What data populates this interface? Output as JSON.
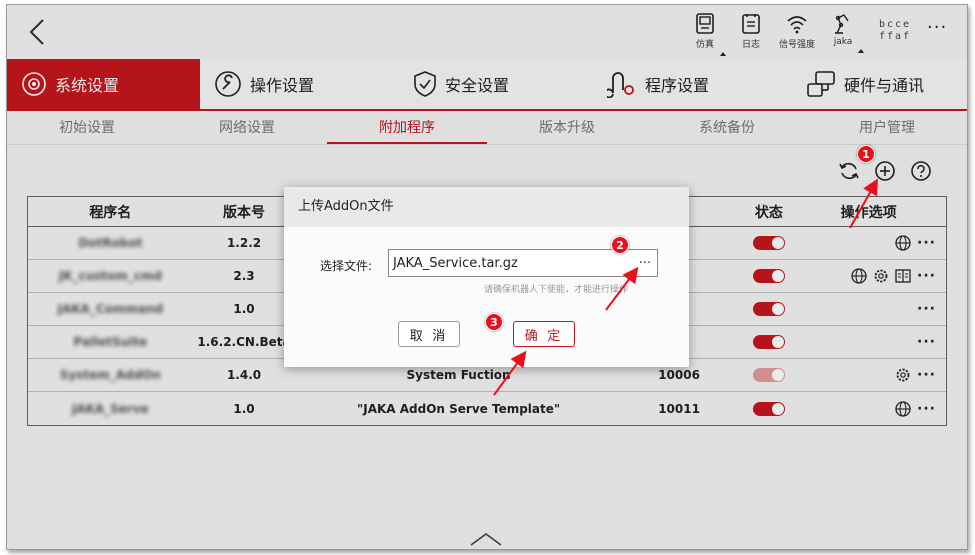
{
  "topbar": {
    "items": [
      {
        "label": "仿真",
        "icon": "simulation-icon"
      },
      {
        "label": "日志",
        "icon": "log-icon"
      },
      {
        "label": "信号强度",
        "icon": "wifi-icon"
      },
      {
        "label": "jaka",
        "icon": "robot-arm-icon"
      }
    ],
    "user_code_line1": "bcce",
    "user_code_line2": "ffaf",
    "more": "···"
  },
  "main_tabs": [
    {
      "label": "系统设置",
      "icon": "gear-cycle-icon",
      "active": true
    },
    {
      "label": "操作设置",
      "icon": "wrench-icon",
      "active": false
    },
    {
      "label": "安全设置",
      "icon": "shield-icon",
      "active": false
    },
    {
      "label": "程序设置",
      "icon": "program-icon",
      "active": false
    },
    {
      "label": "硬件与通讯",
      "icon": "hardware-icon",
      "active": false
    }
  ],
  "sub_tabs": [
    {
      "label": "初始设置",
      "active": false
    },
    {
      "label": "网络设置",
      "active": false
    },
    {
      "label": "附加程序",
      "active": true
    },
    {
      "label": "版本升级",
      "active": false
    },
    {
      "label": "系统备份",
      "active": false
    },
    {
      "label": "用户管理",
      "active": false
    }
  ],
  "table": {
    "headers": {
      "name": "程序名",
      "version": "版本号",
      "description": "",
      "id": "",
      "state": "状态",
      "ops": "操作选项"
    },
    "rows": [
      {
        "name": "DotRobot",
        "version": "1.2.2",
        "description": "",
        "id": "",
        "enabled": true,
        "ops": [
          "globe-icon"
        ]
      },
      {
        "name": "JK_custom_cmd",
        "version": "2.3",
        "description": "",
        "id": "",
        "enabled": true,
        "ops": [
          "globe-icon",
          "gear-icon",
          "book-icon"
        ]
      },
      {
        "name": "JAKA_Command",
        "version": "1.0",
        "description": "",
        "id": "",
        "enabled": true,
        "ops": []
      },
      {
        "name": "PalletSuite",
        "version": "1.6.2.CN.Beta",
        "description": "",
        "id": "",
        "enabled": true,
        "ops": []
      },
      {
        "name": "System_AddOn",
        "version": "1.4.0",
        "description": "System Fuction",
        "id": "10006",
        "enabled": true,
        "disabled_toggle": true,
        "ops": [
          "gear-icon"
        ]
      },
      {
        "name": "JAKA_Serve",
        "version": "1.0",
        "description": "\"JAKA AddOn Serve Template\"",
        "id": "10011",
        "enabled": true,
        "ops": [
          "globe-icon"
        ]
      }
    ],
    "more": "···"
  },
  "dialog": {
    "title": "上传AddOn文件",
    "file_label": "选择文件:",
    "file_value": "JAKA_Service.tar.gz",
    "browse": "···",
    "hint": "请确保机器人下使能，才能进行操作",
    "cancel": "取 消",
    "confirm": "确 定"
  },
  "markers": [
    "1",
    "2",
    "3"
  ],
  "colors": {
    "accent": "#c5161d",
    "marker": "#e8101a"
  }
}
